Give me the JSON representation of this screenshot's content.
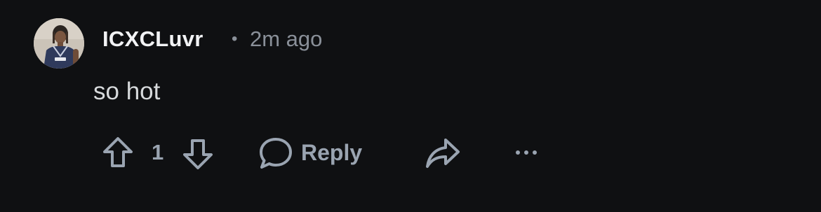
{
  "comment": {
    "author": "ICXCLuvr",
    "separator": "•",
    "time_ago": "2m ago",
    "text": "so hot",
    "vote_count": "1",
    "reply_label": "Reply",
    "more_label": "···"
  },
  "colors": {
    "background": "#0f1012",
    "username": "#f2f3f5",
    "muted": "#8a9099",
    "action": "#9aa4b1",
    "body_text": "#d7dadc"
  },
  "icons": {
    "upvote": "arrow-up-outline-icon",
    "downvote": "arrow-down-outline-icon",
    "reply": "speech-bubble-icon",
    "share": "share-arrow-icon",
    "more": "ellipsis-icon"
  }
}
